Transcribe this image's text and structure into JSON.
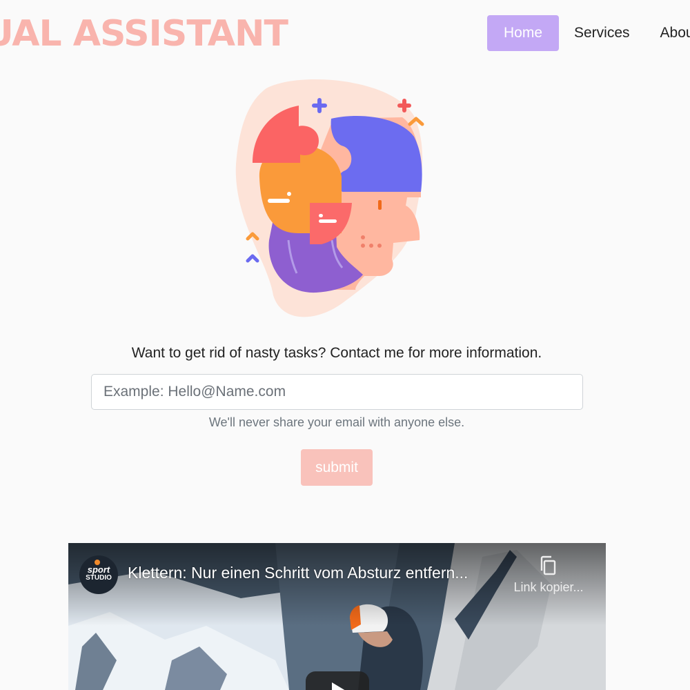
{
  "brand": {
    "title": "VIRTUAL ASSISTANT"
  },
  "nav": {
    "items": [
      "Home",
      "Services",
      "About"
    ]
  },
  "contact": {
    "tagline": "Want to get rid of nasty tasks? Contact me for more information.",
    "email_placeholder": "Example: Hello@Name.com",
    "help_text": "We'll never share your email with anyone else.",
    "submit_label": "submit"
  },
  "video": {
    "channel_line1": "sport",
    "channel_line2": "STUDIO",
    "title": "Klettern: Nur einen Schritt vom Absturz entfern...",
    "copy_label": "Link kopier..."
  },
  "colors": {
    "brand": "#f9b4ad",
    "nav_active": "#c3a8f5",
    "submit": "#f9c2bb"
  },
  "icons": [
    "puzzle-head-illustration",
    "copy-icon",
    "play-icon"
  ]
}
